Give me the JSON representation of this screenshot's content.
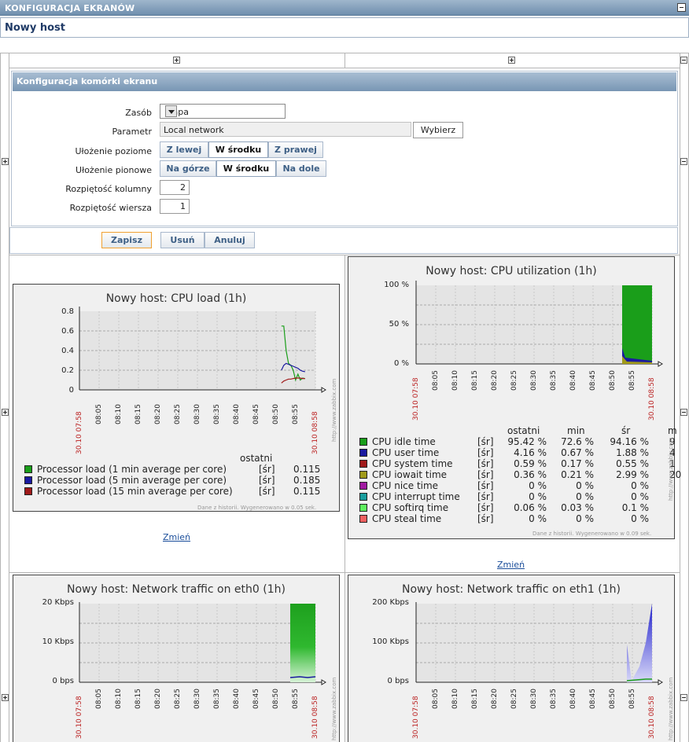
{
  "header": {
    "title": "KONFIGURACJA EKRANÓW"
  },
  "page_title": "Nowy host",
  "cfg": {
    "title": "Konfiguracja komórki ekranu",
    "resource_label": "Zasób",
    "resource_value": "Mapa",
    "param_label": "Parametr",
    "param_value": "Local network",
    "select_button": "Wybierz",
    "halign_label": "Ułożenie poziome",
    "halign": [
      "Z lewej",
      "W środku",
      "Z prawej"
    ],
    "valign_label": "Ułożenie pionowe",
    "valign": [
      "Na górze",
      "W środku",
      "Na dole"
    ],
    "colspan_label": "Rozpiętość kolumny",
    "colspan_value": "2",
    "rowspan_label": "Rozpiętość wiersza",
    "rowspan_value": "1",
    "save": "Zapisz",
    "delete": "Usuń",
    "cancel": "Anuluj"
  },
  "change_link": "Zmień",
  "footer_cpu_load": "Dane z historii. Wygenerowano w 0.05 sek.",
  "footer_cpu_util": "Dane z historii. Wygenerowano w 0.09 sek.",
  "watermark": "http://www.zabbix.com",
  "colors": {
    "green": "#1a9e1a",
    "blue": "#1a1aa0",
    "red": "#a01a1a",
    "header": "#7896b4"
  },
  "chart_data": [
    {
      "type": "line",
      "title": "Nowy host: CPU load (1h)",
      "yticks": [
        "0.8",
        "0.6",
        "0.4",
        "0.2",
        "0"
      ],
      "ylim": [
        0,
        0.8
      ],
      "xticks": [
        "30.10 07:58",
        "08:05",
        "08:10",
        "08:15",
        "08:20",
        "08:25",
        "08:30",
        "08:35",
        "08:40",
        "08:45",
        "08:50",
        "08:55",
        "30.10 08:58"
      ],
      "legend_header": "ostatni",
      "series": [
        {
          "name": "Processor load (1 min average per core)",
          "agg": "[śr]",
          "last": "0.115",
          "color": "#1a9e1a",
          "points": [
            [
              0.856,
              0.65
            ],
            [
              0.866,
              0.65
            ],
            [
              0.876,
              0.4
            ],
            [
              0.886,
              0.27
            ],
            [
              0.896,
              0.25
            ],
            [
              0.906,
              0.2
            ],
            [
              0.916,
              0.1
            ],
            [
              0.926,
              0.16
            ],
            [
              0.936,
              0.1
            ],
            [
              0.946,
              0.12
            ],
            [
              0.956,
              0.115
            ]
          ]
        },
        {
          "name": "Processor load (5 min average per core)",
          "agg": "[śr]",
          "last": "0.185",
          "color": "#1a1aa0",
          "points": [
            [
              0.856,
              0.2
            ],
            [
              0.866,
              0.25
            ],
            [
              0.876,
              0.27
            ],
            [
              0.886,
              0.26
            ],
            [
              0.896,
              0.25
            ],
            [
              0.906,
              0.24
            ],
            [
              0.916,
              0.23
            ],
            [
              0.926,
              0.22
            ],
            [
              0.936,
              0.2
            ],
            [
              0.946,
              0.19
            ],
            [
              0.956,
              0.185
            ]
          ]
        },
        {
          "name": "Processor load (15 min average per core)",
          "agg": "[śr]",
          "last": "0.115",
          "color": "#a01a1a",
          "points": [
            [
              0.856,
              0.07
            ],
            [
              0.866,
              0.09
            ],
            [
              0.876,
              0.1
            ],
            [
              0.886,
              0.11
            ],
            [
              0.896,
              0.11
            ],
            [
              0.906,
              0.115
            ],
            [
              0.916,
              0.12
            ],
            [
              0.926,
              0.12
            ],
            [
              0.936,
              0.12
            ],
            [
              0.946,
              0.115
            ],
            [
              0.956,
              0.115
            ]
          ]
        }
      ]
    },
    {
      "type": "area",
      "title": "Nowy host: CPU utilization (1h)",
      "yticks": [
        "100 %",
        "50 %",
        "0 %"
      ],
      "ylim": [
        0,
        100
      ],
      "xticks": [
        "30.10 07:58",
        "08:05",
        "08:10",
        "08:15",
        "08:20",
        "08:25",
        "08:30",
        "08:35",
        "08:40",
        "08:45",
        "08:50",
        "08:55",
        "30.10 08:58"
      ],
      "columns": [
        "ostatni",
        "min",
        "śr",
        "m"
      ],
      "series": [
        {
          "name": "CPU idle time",
          "agg": "[śr]",
          "last": "95.42 %",
          "min": "72.6 %",
          "avg": "94.16 %",
          "max": "9",
          "color": "#1a9e1a"
        },
        {
          "name": "CPU user time",
          "agg": "[śr]",
          "last": "4.16 %",
          "min": "0.67 %",
          "avg": "1.88 %",
          "max": "4",
          "color": "#1a1aa0"
        },
        {
          "name": "CPU system time",
          "agg": "[śr]",
          "last": "0.59 %",
          "min": "0.17 %",
          "avg": "0.55 %",
          "max": "1",
          "color": "#a01a1a"
        },
        {
          "name": "CPU iowait time",
          "agg": "[śr]",
          "last": "0.36 %",
          "min": "0.21 %",
          "avg": "2.99 %",
          "max": "20",
          "color": "#a09a1a"
        },
        {
          "name": "CPU nice time",
          "agg": "[śr]",
          "last": "0 %",
          "min": "0 %",
          "avg": "0 %",
          "max": "",
          "color": "#a01aa0"
        },
        {
          "name": "CPU interrupt time",
          "agg": "[śr]",
          "last": "0 %",
          "min": "0 %",
          "avg": "0 %",
          "max": "",
          "color": "#1a9e9e"
        },
        {
          "name": "CPU softirq time",
          "agg": "[śr]",
          "last": "0.06 %",
          "min": "0.03 %",
          "avg": "0.1 %",
          "max": "",
          "color": "#5ef05e"
        },
        {
          "name": "CPU steal time",
          "agg": "[śr]",
          "last": "0 %",
          "min": "0 %",
          "avg": "0 %",
          "max": "",
          "color": "#f06060"
        }
      ]
    },
    {
      "type": "area",
      "title": "Nowy host: Network traffic on eth0 (1h)",
      "yticks": [
        "20 Kbps",
        "10 Kbps",
        "0 bps"
      ],
      "ylim": [
        0,
        20
      ],
      "xticks": [
        "30.10 07:58",
        "08:05",
        "08:10",
        "08:15",
        "08:20",
        "08:25",
        "08:30",
        "08:35",
        "08:40",
        "08:45",
        "08:50",
        "08:55",
        "30.10 08:58"
      ]
    },
    {
      "type": "area",
      "title": "Nowy host: Network traffic on eth1 (1h)",
      "yticks": [
        "200 Kbps",
        "100 Kbps",
        "0 bps"
      ],
      "ylim": [
        0,
        200
      ],
      "xticks": [
        "30.10 07:58",
        "08:05",
        "08:10",
        "08:15",
        "08:20",
        "08:25",
        "08:30",
        "08:35",
        "08:40",
        "08:45",
        "08:50",
        "08:55",
        "30.10 08:58"
      ]
    }
  ]
}
